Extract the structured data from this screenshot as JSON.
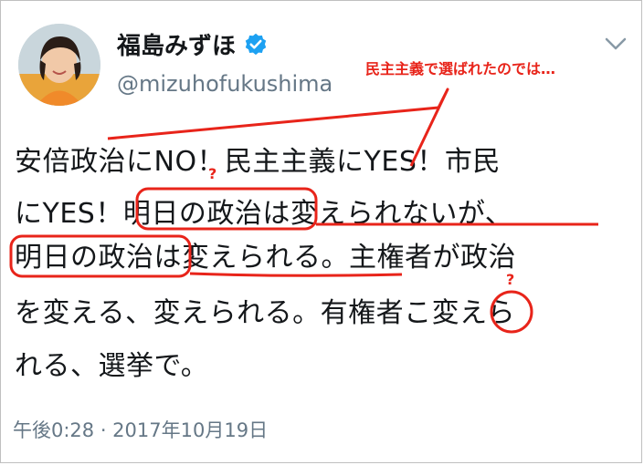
{
  "colors": {
    "annotation": "#e8241a",
    "verified": "#1da1f2",
    "secondary_text": "#657786"
  },
  "tweet": {
    "display_name": "福島みずほ",
    "verified_icon": "verified-badge-icon",
    "handle": "@mizuhofukushima",
    "menu_icon": "chevron-down-icon",
    "lines": [
      "安倍政治にNO！民主主義にYES！市民",
      "にYES！明日の政治は変えられないが、",
      "明日の政治は変えられる。主権者が政治",
      "を変える、変えられる。有権者こ変えら",
      "れる、選挙で。"
    ],
    "timestamp": "午後0:28 · 2017年10月19日"
  },
  "annotation": {
    "callout": "民主主義で選ばれたのでは…",
    "marks": [
      "?",
      "?"
    ]
  }
}
